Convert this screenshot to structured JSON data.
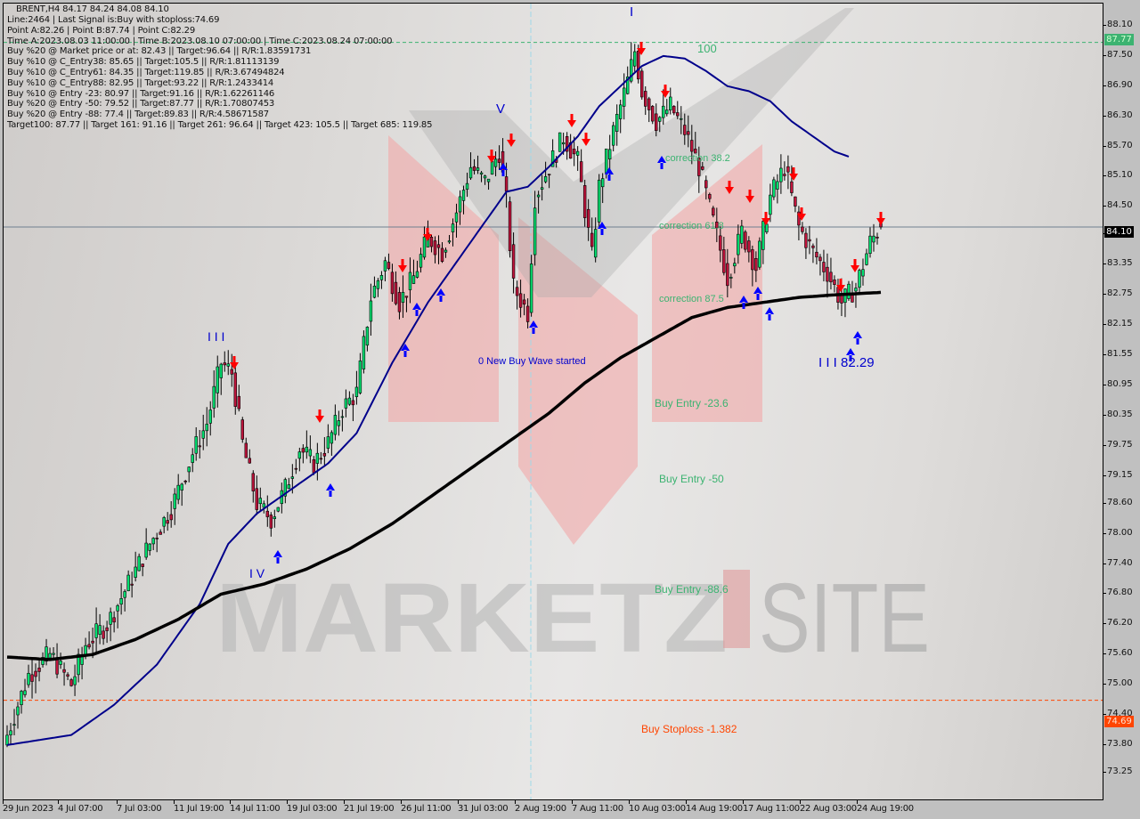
{
  "header": {
    "symbol_line": "BRENT,H4  84.17 84.24 84.08 84.10",
    "info_lines": [
      "Line:2464 | Last Signal is:Buy with stoploss:74.69",
      "Point A:82.26 | Point B:87.74 | Point C:82.29",
      "Time A:2023.08.03 11:00:00 | Time B:2023.08.10 07:00:00 | Time C:2023.08.24 07:00:00",
      "Buy %20 @ Market price or at: 82.43 || Target:96.64 || R/R:1.83591731",
      "Buy %10 @ C_Entry38: 85.65 || Target:105.5 || R/R:1.81113139",
      "Buy %10 @ C_Entry61: 84.35 || Target:119.85 || R/R:3.67494824",
      "Buy %10 @ C_Entry88: 82.95 || Target:93.22 || R/R:1.2433414",
      "Buy %10 @ Entry -23: 80.97 || Target:91.16 || R/R:1.62261146",
      "Buy %20 @ Entry -50: 79.52 || Target:87.77 || R/R:1.70807453",
      "Buy %20 @ Entry -88: 77.4 || Target:89.83 || R/R:4.58671587",
      "Target100: 87.77 || Target 161: 91.16 || Target 261: 96.64 || Target 423: 105.5 || Target 685: 119.85"
    ]
  },
  "price_tags": {
    "target": {
      "value": "87.77",
      "color": "#3cb371"
    },
    "current": {
      "value": "84.10",
      "color": "#000000"
    },
    "stoploss": {
      "value": "74.69",
      "color": "#ff4500"
    }
  },
  "annotations": {
    "wave_1": "I",
    "wave_3": "I I I",
    "wave_4": "I V",
    "wave_5": "V",
    "wave_c": "I I I 82.29",
    "level_100": "100",
    "correction_38": "correction 38.2",
    "correction_61": "correction 61.8",
    "correction_87": "correction 87.5",
    "new_wave": "0 New Buy Wave started",
    "buy_entry_23": "Buy Entry -23.6",
    "buy_entry_50": "Buy Entry -50",
    "buy_entry_88": "Buy Entry -88.6",
    "buy_stoploss": "Buy Stoploss -1.382"
  },
  "colors": {
    "bull": "#00e070",
    "bear": "#c0143c",
    "ma_fast": "#00008b",
    "ma_slow": "#000000",
    "fib_text": "#3cb371",
    "wave_text": "#0000cd",
    "stoploss": "#ff4500"
  },
  "chart_data": {
    "type": "candlestick",
    "title": "BRENT,H4",
    "symbol": "BRENT",
    "timeframe": "H4",
    "ohlc_last": {
      "open": 84.17,
      "high": 84.24,
      "low": 84.08,
      "close": 84.1
    },
    "ylim": [
      73.25,
      88.3
    ],
    "y_ticks": [
      "88.10",
      "87.50",
      "86.90",
      "86.30",
      "85.70",
      "85.10",
      "84.50",
      "83.95",
      "83.35",
      "82.75",
      "82.15",
      "81.55",
      "80.95",
      "80.35",
      "79.75",
      "79.15",
      "78.60",
      "78.00",
      "77.40",
      "76.80",
      "76.20",
      "75.60",
      "75.00",
      "74.40",
      "73.80",
      "73.25"
    ],
    "x_ticks": [
      "29 Jun 2023",
      "4 Jul 07:00",
      "7 Jul 03:00",
      "11 Jul 19:00",
      "14 Jul 11:00",
      "19 Jul 03:00",
      "21 Jul 19:00",
      "26 Jul 11:00",
      "31 Jul 03:00",
      "2 Aug 19:00",
      "7 Aug 11:00",
      "10 Aug 03:00",
      "14 Aug 19:00",
      "17 Aug 11:00",
      "22 Aug 03:00",
      "24 Aug 19:00"
    ],
    "horizontal_lines": [
      {
        "name": "target100",
        "value": 87.77,
        "style": "dashed",
        "color": "#3cb371"
      },
      {
        "name": "current_price",
        "value": 84.1,
        "style": "solid",
        "color": "#708090"
      },
      {
        "name": "stoploss",
        "value": 74.69,
        "style": "dashed",
        "color": "#ff4500"
      }
    ],
    "close_path": [
      {
        "i": 0,
        "c": 74.0
      },
      {
        "i": 6,
        "c": 75.2
      },
      {
        "i": 12,
        "c": 75.6
      },
      {
        "i": 18,
        "c": 75.0
      },
      {
        "i": 22,
        "c": 75.8
      },
      {
        "i": 28,
        "c": 76.2
      },
      {
        "i": 34,
        "c": 77.0
      },
      {
        "i": 40,
        "c": 77.8
      },
      {
        "i": 46,
        "c": 78.5
      },
      {
        "i": 52,
        "c": 79.6
      },
      {
        "i": 56,
        "c": 80.2
      },
      {
        "i": 60,
        "c": 81.4
      },
      {
        "i": 63,
        "c": 81.2
      },
      {
        "i": 66,
        "c": 79.8
      },
      {
        "i": 70,
        "c": 78.6
      },
      {
        "i": 74,
        "c": 78.3
      },
      {
        "i": 78,
        "c": 78.9
      },
      {
        "i": 82,
        "c": 79.7
      },
      {
        "i": 86,
        "c": 79.4
      },
      {
        "i": 90,
        "c": 79.8
      },
      {
        "i": 94,
        "c": 80.5
      },
      {
        "i": 98,
        "c": 80.8
      },
      {
        "i": 102,
        "c": 82.7
      },
      {
        "i": 106,
        "c": 83.4
      },
      {
        "i": 110,
        "c": 82.6
      },
      {
        "i": 114,
        "c": 83.1
      },
      {
        "i": 118,
        "c": 83.9
      },
      {
        "i": 122,
        "c": 83.6
      },
      {
        "i": 126,
        "c": 84.4
      },
      {
        "i": 130,
        "c": 85.3
      },
      {
        "i": 134,
        "c": 85.0
      },
      {
        "i": 138,
        "c": 85.6
      },
      {
        "i": 140,
        "c": 84.6
      },
      {
        "i": 142,
        "c": 82.9
      },
      {
        "i": 146,
        "c": 82.4
      },
      {
        "i": 148,
        "c": 84.7
      },
      {
        "i": 152,
        "c": 85.3
      },
      {
        "i": 156,
        "c": 85.9
      },
      {
        "i": 160,
        "c": 85.4
      },
      {
        "i": 164,
        "c": 83.5
      },
      {
        "i": 166,
        "c": 84.9
      },
      {
        "i": 170,
        "c": 86.0
      },
      {
        "i": 174,
        "c": 87.0
      },
      {
        "i": 176,
        "c": 87.6
      },
      {
        "i": 178,
        "c": 86.8
      },
      {
        "i": 182,
        "c": 86.2
      },
      {
        "i": 186,
        "c": 86.5
      },
      {
        "i": 190,
        "c": 86.0
      },
      {
        "i": 194,
        "c": 85.3
      },
      {
        "i": 198,
        "c": 84.2
      },
      {
        "i": 202,
        "c": 83.1
      },
      {
        "i": 206,
        "c": 84.0
      },
      {
        "i": 210,
        "c": 83.3
      },
      {
        "i": 214,
        "c": 84.7
      },
      {
        "i": 218,
        "c": 85.3
      },
      {
        "i": 222,
        "c": 84.1
      },
      {
        "i": 226,
        "c": 83.6
      },
      {
        "i": 230,
        "c": 83.2
      },
      {
        "i": 234,
        "c": 82.6
      },
      {
        "i": 238,
        "c": 82.9
      },
      {
        "i": 242,
        "c": 83.8
      },
      {
        "i": 245,
        "c": 84.1
      }
    ],
    "ma_fast": [
      {
        "i": 0,
        "v": 73.8
      },
      {
        "i": 18,
        "v": 74.0
      },
      {
        "i": 30,
        "v": 74.6
      },
      {
        "i": 42,
        "v": 75.4
      },
      {
        "i": 54,
        "v": 76.6
      },
      {
        "i": 62,
        "v": 77.8
      },
      {
        "i": 70,
        "v": 78.4
      },
      {
        "i": 80,
        "v": 78.9
      },
      {
        "i": 90,
        "v": 79.4
      },
      {
        "i": 98,
        "v": 80.0
      },
      {
        "i": 108,
        "v": 81.4
      },
      {
        "i": 118,
        "v": 82.6
      },
      {
        "i": 126,
        "v": 83.4
      },
      {
        "i": 134,
        "v": 84.2
      },
      {
        "i": 140,
        "v": 84.8
      },
      {
        "i": 146,
        "v": 84.9
      },
      {
        "i": 152,
        "v": 85.3
      },
      {
        "i": 160,
        "v": 85.9
      },
      {
        "i": 166,
        "v": 86.5
      },
      {
        "i": 172,
        "v": 86.9
      },
      {
        "i": 178,
        "v": 87.3
      },
      {
        "i": 184,
        "v": 87.5
      },
      {
        "i": 190,
        "v": 87.45
      },
      {
        "i": 196,
        "v": 87.2
      },
      {
        "i": 202,
        "v": 86.9
      },
      {
        "i": 208,
        "v": 86.8
      },
      {
        "i": 214,
        "v": 86.6
      },
      {
        "i": 220,
        "v": 86.2
      },
      {
        "i": 226,
        "v": 85.9
      },
      {
        "i": 232,
        "v": 85.6
      },
      {
        "i": 236,
        "v": 85.5
      }
    ],
    "ma_slow": [
      {
        "i": 0,
        "v": 75.55
      },
      {
        "i": 12,
        "v": 75.5
      },
      {
        "i": 24,
        "v": 75.6
      },
      {
        "i": 36,
        "v": 75.9
      },
      {
        "i": 48,
        "v": 76.3
      },
      {
        "i": 60,
        "v": 76.8
      },
      {
        "i": 72,
        "v": 77.0
      },
      {
        "i": 84,
        "v": 77.3
      },
      {
        "i": 96,
        "v": 77.7
      },
      {
        "i": 108,
        "v": 78.2
      },
      {
        "i": 120,
        "v": 78.8
      },
      {
        "i": 132,
        "v": 79.4
      },
      {
        "i": 142,
        "v": 79.9
      },
      {
        "i": 152,
        "v": 80.4
      },
      {
        "i": 162,
        "v": 81.0
      },
      {
        "i": 172,
        "v": 81.5
      },
      {
        "i": 182,
        "v": 81.9
      },
      {
        "i": 192,
        "v": 82.3
      },
      {
        "i": 202,
        "v": 82.5
      },
      {
        "i": 212,
        "v": 82.6
      },
      {
        "i": 222,
        "v": 82.7
      },
      {
        "i": 232,
        "v": 82.75
      },
      {
        "i": 245,
        "v": 82.8
      }
    ],
    "bar_count": 246
  }
}
